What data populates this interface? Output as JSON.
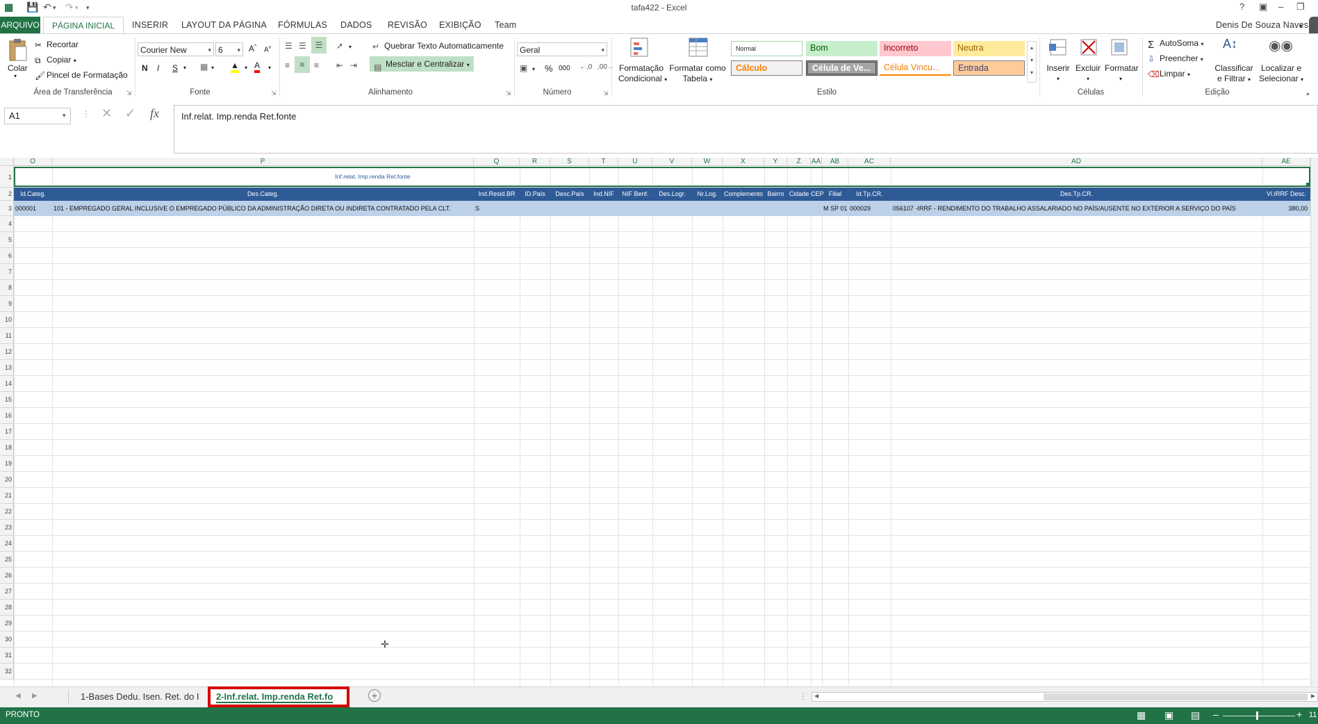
{
  "window": {
    "title": "tafa422 - Excel",
    "user": "Denis De Souza Naves"
  },
  "ribbon_tabs": [
    "ARQUIVO",
    "PÁGINA INICIAL",
    "INSERIR",
    "LAYOUT DA PÁGINA",
    "FÓRMULAS",
    "DADOS",
    "REVISÃO",
    "EXIBIÇÃO",
    "Team"
  ],
  "clipboard": {
    "paste": "Colar",
    "cut": "Recortar",
    "copy": "Copiar",
    "format_painter": "Pincel de Formatação",
    "label": "Área de Transferência"
  },
  "font": {
    "name": "Courier New",
    "size": "6",
    "bold": "N",
    "italic": "I",
    "underline": "S",
    "label": "Fonte"
  },
  "alignment": {
    "wrap": "Quebrar Texto Automaticamente",
    "merge": "Mesclar e Centralizar",
    "label": "Alinhamento"
  },
  "number": {
    "format": "Geral",
    "percent": "%",
    "thousands": "000",
    "label": "Número"
  },
  "styles": {
    "cond_format_1": "Formatação",
    "cond_format_2": "Condicional",
    "table_1": "Formatar como",
    "table_2": "Tabela",
    "normal": "Normal",
    "bom": "Bom",
    "incorreto": "Incorreto",
    "neutra": "Neutra",
    "calculo": "Cálculo",
    "celula_ve": "Célula de Ve...",
    "celula_vinc": "Célula Vincu...",
    "entrada": "Entrada",
    "label": "Estilo"
  },
  "cells": {
    "insert": "Inserir",
    "delete": "Excluir",
    "format": "Formatar",
    "label": "Células"
  },
  "editing": {
    "autosum": "AutoSoma",
    "fill": "Preencher",
    "clear": "Limpar",
    "sort_1": "Classificar",
    "sort_2": "e Filtrar",
    "find_1": "Localizar e",
    "find_2": "Selecionar",
    "label": "Edição"
  },
  "formula_bar": {
    "name_box": "A1",
    "fx": "fx",
    "content": "Inf.relat. Imp.renda Ret.fonte"
  },
  "columns": [
    "O",
    "P",
    "Q",
    "R",
    "S",
    "T",
    "U",
    "V",
    "W",
    "X",
    "Y",
    "Z",
    "AA",
    "AB",
    "AC",
    "AD",
    "AE"
  ],
  "row1_title": "Inf.relat. Imp.renda Ret.fonte",
  "headers": [
    "Id.Categ.",
    "Des.Categ.",
    "Ind.Resid.BR",
    "ID.País",
    "Desc.País",
    "Ind.NIF",
    "NIF Benf.",
    "Des.Logr.",
    "Nr.Log.",
    "Complemento",
    "Bairro",
    "Cidade",
    "CEP",
    "Filial",
    "Id.Tp.CR.",
    "Des.Tp.CR.",
    "Vl.IRRF Desc."
  ],
  "row3": [
    "000001",
    "101 - EMPREGADO  GERAL INCLUSIVE O EMPREGADO PÚBLICO DA ADMINISTRAÇÃO DIRETA OU INDIRETA CONTRATADO PELA CLT.",
    "S",
    "M SP 01",
    "000029",
    "056107  -IRRF - RENDIMENTO DO TRABALHO ASSALARIADO NO PAÍS/AUSENTE NO EXTERIOR A SERVIÇO DO PAÍS",
    "380,00"
  ],
  "row_numbers": [
    "1",
    "2",
    "3",
    "4",
    "5",
    "6",
    "7",
    "8",
    "9",
    "10",
    "11",
    "12",
    "13",
    "14",
    "15",
    "16",
    "17",
    "18",
    "19",
    "20",
    "21",
    "22",
    "23",
    "24",
    "25",
    "26",
    "27",
    "28",
    "29",
    "30",
    "31",
    "32"
  ],
  "sheets": {
    "tab1": "1-Bases Dedu. Isen. Ret. do I",
    "tab2": "2-Inf.relat. Imp.renda Ret.fo"
  },
  "status": {
    "ready": "PRONTO",
    "zoom": "11"
  },
  "colors": {
    "excel_green": "#217346",
    "header_blue": "#2e5a96",
    "row_blue": "#bcd0e8",
    "highlight_red": "#d40000"
  }
}
